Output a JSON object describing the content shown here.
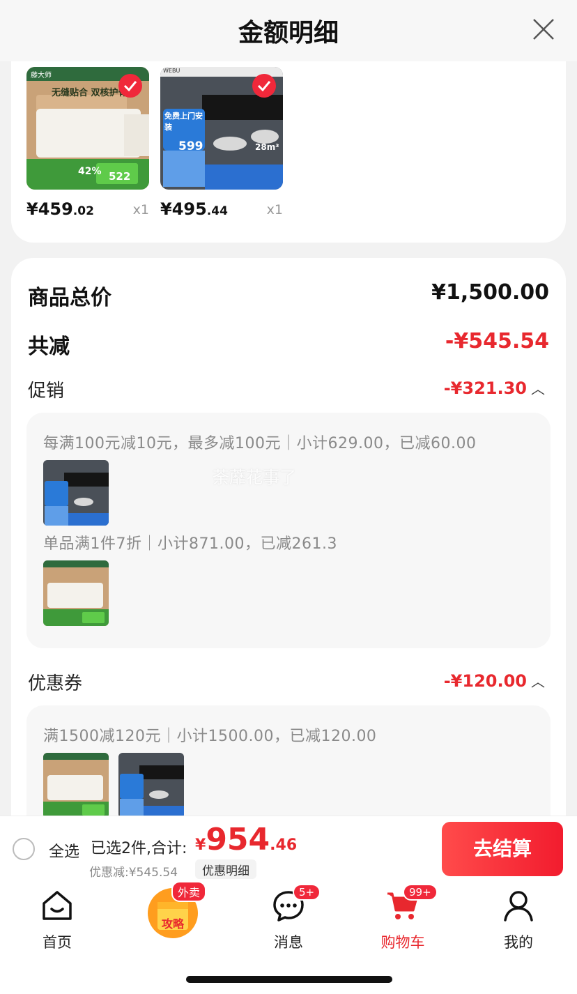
{
  "header": {
    "title": "金额明细"
  },
  "products": [
    {
      "price_int": "¥459",
      "price_dec": ".02",
      "qty": "x1",
      "img_texts": {
        "brand": "藤大师",
        "headline": "无缝贴合 双核护脊",
        "badge_price": "522",
        "pct": "42%"
      }
    },
    {
      "price_int": "¥495",
      "price_dec": ".44",
      "qty": "x1",
      "img_texts": {
        "brand": "WEBU",
        "tag": "免费上门安装",
        "price": "599",
        "power": "28m³"
      }
    }
  ],
  "summary": {
    "total_label": "商品总价",
    "total_value": "¥1,500.00",
    "reduce_label": "共减",
    "reduce_value": "-¥545.54",
    "promo_label": "促销",
    "promo_value": "-¥321.30",
    "promo_rules": [
      "每满100元减10元，最多减100元｜小计629.00，已减60.00",
      "单品满1件7折｜小计871.00，已减261.3"
    ],
    "coupon_label": "优惠券",
    "coupon_value": "-¥120.00",
    "coupon_rule": "满1500减120元｜小计1500.00，已减120.00",
    "watermark": "荼蘼花事了"
  },
  "bottom": {
    "select_all": "全选",
    "sum_label": "已选2件,合计:",
    "sum_yen": "¥",
    "sum_int": "954",
    "sum_dec": ".46",
    "discount_label": "优惠减:¥545.54",
    "detail_link": "优惠明细",
    "checkout": "去结算"
  },
  "tabs": [
    {
      "label": "首页",
      "icon": "home-icon"
    },
    {
      "label": "攻略",
      "icon": "guide-box-icon",
      "badge": "外卖"
    },
    {
      "label": "消息",
      "icon": "message-icon",
      "badge": "5+"
    },
    {
      "label": "购物车",
      "icon": "cart-icon",
      "badge": "99+"
    },
    {
      "label": "我的",
      "icon": "profile-icon"
    }
  ],
  "colors": {
    "accent": "#e8282e",
    "check": "#f0283a"
  }
}
